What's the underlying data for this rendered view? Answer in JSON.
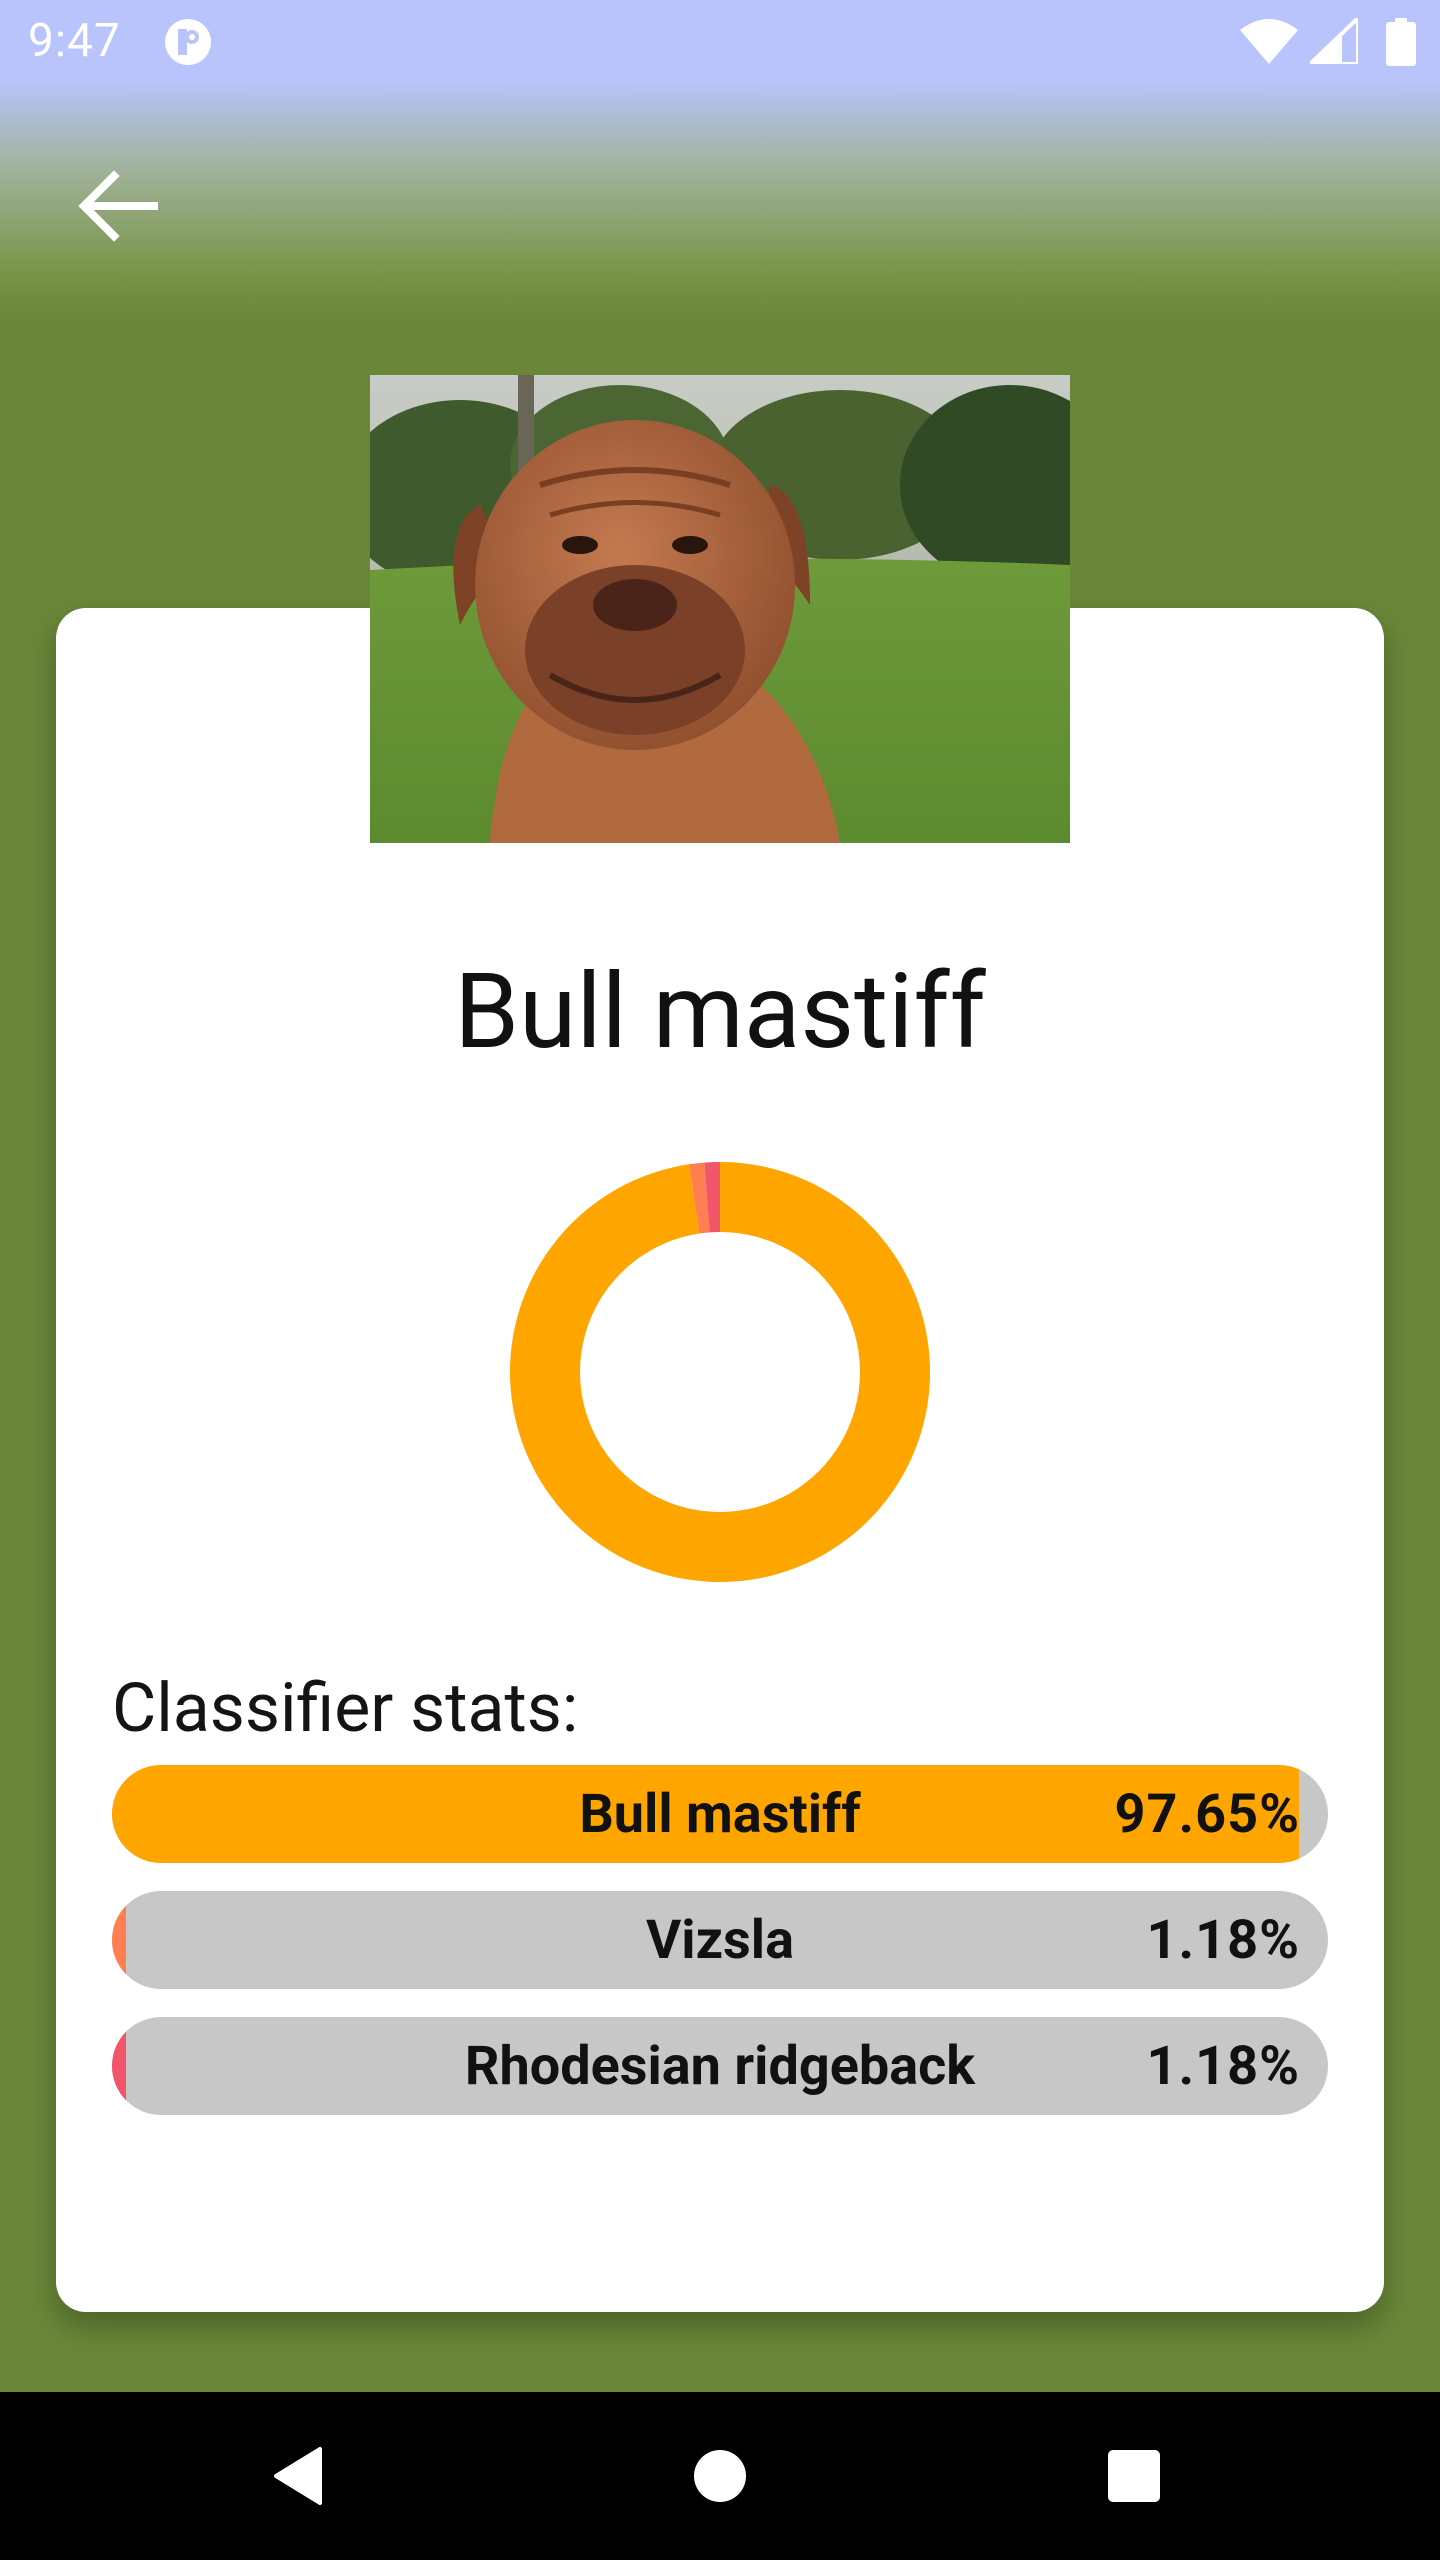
{
  "status_bar": {
    "time": "9:47",
    "icons": [
      "notification-app-icon",
      "wifi-icon",
      "cell-signal-icon",
      "battery-icon"
    ]
  },
  "toolbar": {
    "back_icon": "arrow-back-icon"
  },
  "result": {
    "breed": "Bull mastiff",
    "photo_subject": "dog-photo"
  },
  "chart_data": {
    "type": "pie",
    "style": "donut",
    "categories": [
      "Bull mastiff",
      "Vizsla",
      "Rhodesian ridgeback"
    ],
    "values": [
      97.65,
      1.18,
      1.18
    ],
    "colors": [
      "#ffa500",
      "#ff7f50",
      "#f0556a"
    ]
  },
  "stats": {
    "heading": "Classifier stats:",
    "items": [
      {
        "label": "Bull mastiff",
        "percent_text": "97.65%",
        "value": 97.65,
        "color": "#ffa500"
      },
      {
        "label": "Vizsla",
        "percent_text": "1.18%",
        "value": 1.18,
        "color": "#ff7f50"
      },
      {
        "label": "Rhodesian ridgeback",
        "percent_text": "1.18%",
        "value": 1.18,
        "color": "#f0556a"
      }
    ]
  },
  "nav": {
    "icons": [
      "nav-back-icon",
      "nav-home-icon",
      "nav-recents-icon"
    ]
  }
}
